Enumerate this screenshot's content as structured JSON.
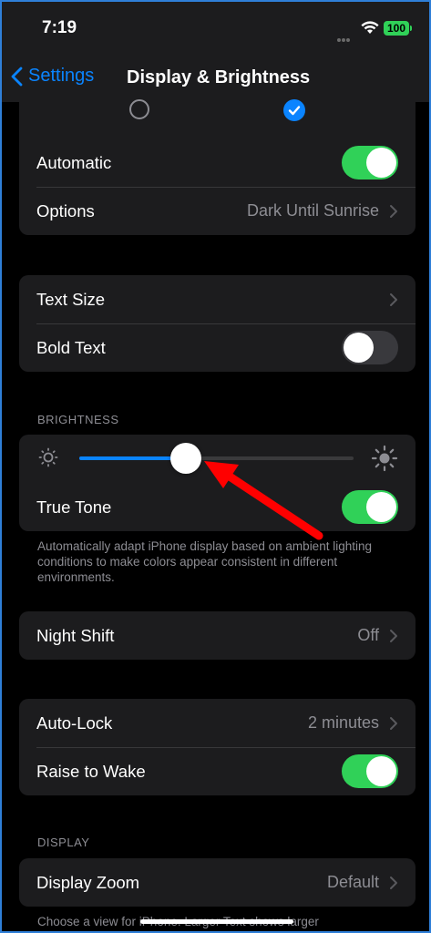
{
  "status": {
    "time": "7:19",
    "battery": "100"
  },
  "nav": {
    "back_label": "Settings",
    "title": "Display & Brightness"
  },
  "appearance": {
    "automatic_label": "Automatic",
    "automatic_on": true,
    "options_label": "Options",
    "options_value": "Dark Until Sunrise"
  },
  "text": {
    "text_size_label": "Text Size",
    "bold_text_label": "Bold Text",
    "bold_text_on": false
  },
  "brightness": {
    "header": "BRIGHTNESS",
    "level": 0.39,
    "true_tone_label": "True Tone",
    "true_tone_on": true,
    "footer": "Automatically adapt iPhone display based on ambient lighting conditions to make colors appear consistent in different environments."
  },
  "night_shift": {
    "label": "Night Shift",
    "value": "Off"
  },
  "lock": {
    "auto_lock_label": "Auto-Lock",
    "auto_lock_value": "2 minutes",
    "raise_to_wake_label": "Raise to Wake",
    "raise_to_wake_on": true
  },
  "display": {
    "header": "DISPLAY",
    "zoom_label": "Display Zoom",
    "zoom_value": "Default",
    "footer": "Choose a view for iPhone. Larger Text shows larger"
  },
  "colors": {
    "accent": "#0a84ff",
    "toggle_on": "#30d158",
    "annotation_arrow": "#ff0000"
  }
}
